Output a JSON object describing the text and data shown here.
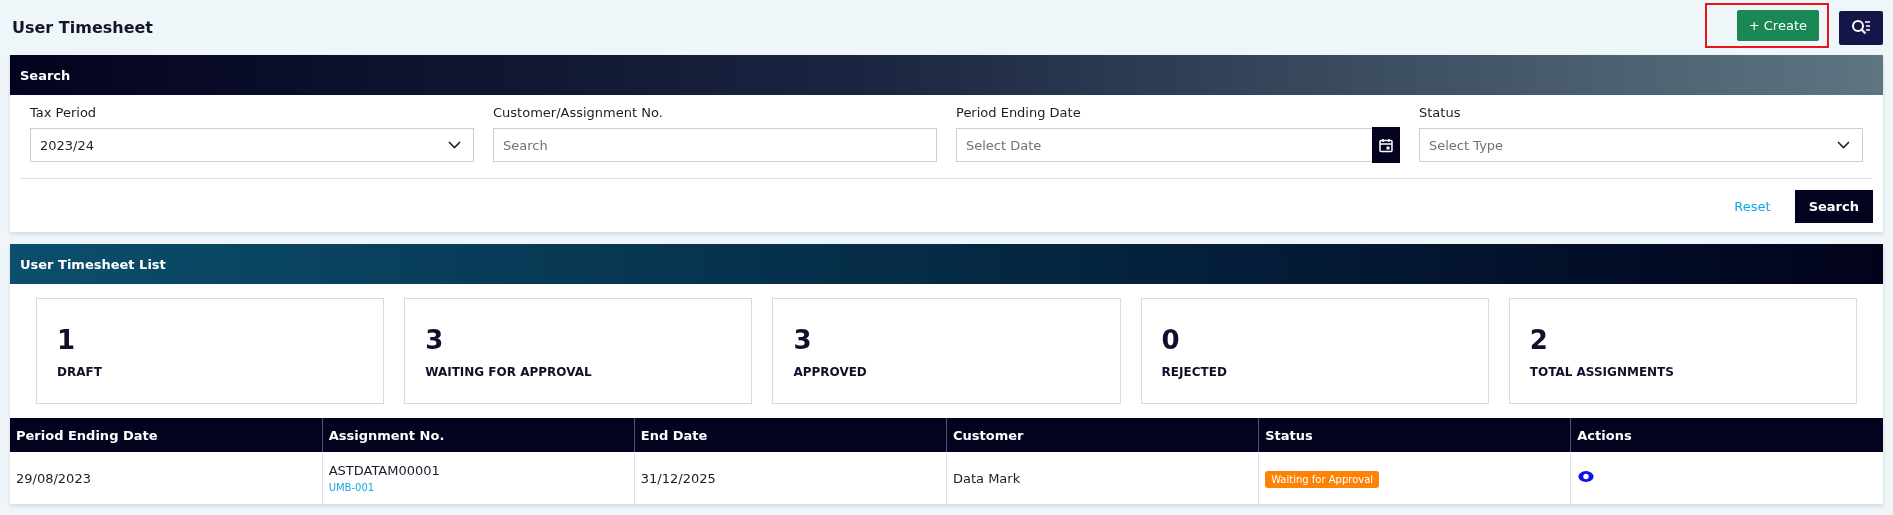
{
  "page_title": "User Timesheet",
  "create_button": {
    "label": "+ Create",
    "highlighted": true
  },
  "search_panel": {
    "title": "Search",
    "fields": [
      {
        "kind": "select",
        "label": "Tax Period",
        "value": "2023/24"
      },
      {
        "kind": "text",
        "label": "Customer/Assignment No.",
        "placeholder": "Search"
      },
      {
        "kind": "date",
        "label": "Period Ending Date",
        "placeholder": "Select Date"
      },
      {
        "kind": "select",
        "label": "Status",
        "placeholder": "Select Type"
      }
    ],
    "reset_link": "Reset",
    "search_button": "Search"
  },
  "list_panel": {
    "title": "User Timesheet List",
    "summary_cards": [
      {
        "count": "1",
        "label": "DRAFT"
      },
      {
        "count": "3",
        "label": "WAITING FOR APPROVAL"
      },
      {
        "count": "3",
        "label": "APPROVED"
      },
      {
        "count": "0",
        "label": "REJECTED"
      },
      {
        "count": "2",
        "label": "TOTAL ASSIGNMENTS"
      }
    ],
    "table": {
      "columns": [
        "Period Ending Date",
        "Assignment No.",
        "End Date",
        "Customer",
        "Status",
        "Actions"
      ],
      "rows": [
        {
          "period_ending_date": "29/08/2023",
          "assignment_no": "ASTDATAM00001",
          "assignment_sub": "UMB-001",
          "end_date": "31/12/2025",
          "customer": "Data Mark",
          "status": "Waiting for Approval",
          "color": "#fd8208"
        }
      ]
    }
  }
}
